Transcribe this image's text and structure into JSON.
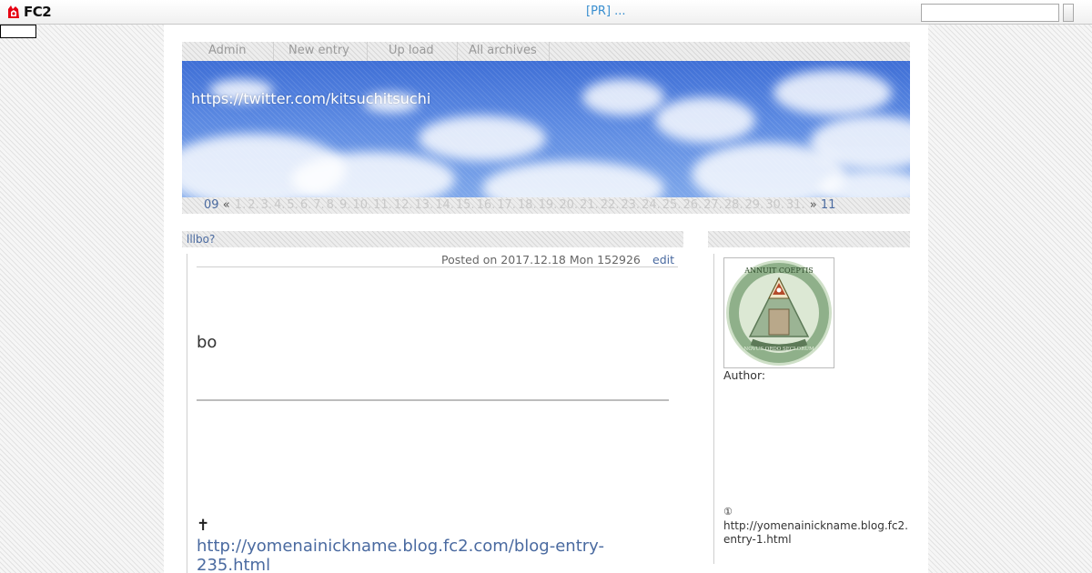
{
  "topbar": {
    "logo_text": "FC2",
    "pr_link": "[PR] ...",
    "search_placeholder": ""
  },
  "menu": {
    "items": [
      {
        "label": "Admin"
      },
      {
        "label": "New entry"
      },
      {
        "label": "Up load"
      },
      {
        "label": "All archives"
      }
    ]
  },
  "header": {
    "title": "https://twitter.com/kitsuchitsuchi"
  },
  "calendar": {
    "prev_month": "09",
    "prev_arrow": "«",
    "days": [
      "1.",
      "2.",
      "3.",
      "4.",
      "5.",
      "6.",
      "7.",
      "8.",
      "9.",
      "10.",
      "11.",
      "12.",
      "13.",
      "14.",
      "15.",
      "16.",
      "17.",
      "18.",
      "19.",
      "20.",
      "21.",
      "22.",
      "23.",
      "24.",
      "25.",
      "26.",
      "27.",
      "28.",
      "29.",
      "30.",
      "31."
    ],
    "next_arrow": "»",
    "next_month": "11"
  },
  "entry": {
    "title": "lllbo?",
    "posted": "Posted on 2017.12.18 Mon 152926",
    "edit_label": "edit",
    "body_text": "bo",
    "dagger": "✝",
    "link": "http://yomenainickname.blog.fc2.com/blog-entry-235.html"
  },
  "sidebar": {
    "author_label": "Author:",
    "circled_number": "①",
    "link_text": "http://yomenainickname.blog.fc2.entry-1.html",
    "avatar_text_top": "ANNUIT COEPTIS",
    "avatar_text_bottom": "NOVUS ORDO SECLORUM"
  },
  "colors": {
    "link": "#4a6aa0",
    "pr": "#3a8fd0",
    "sky": "#4f7fdd"
  }
}
